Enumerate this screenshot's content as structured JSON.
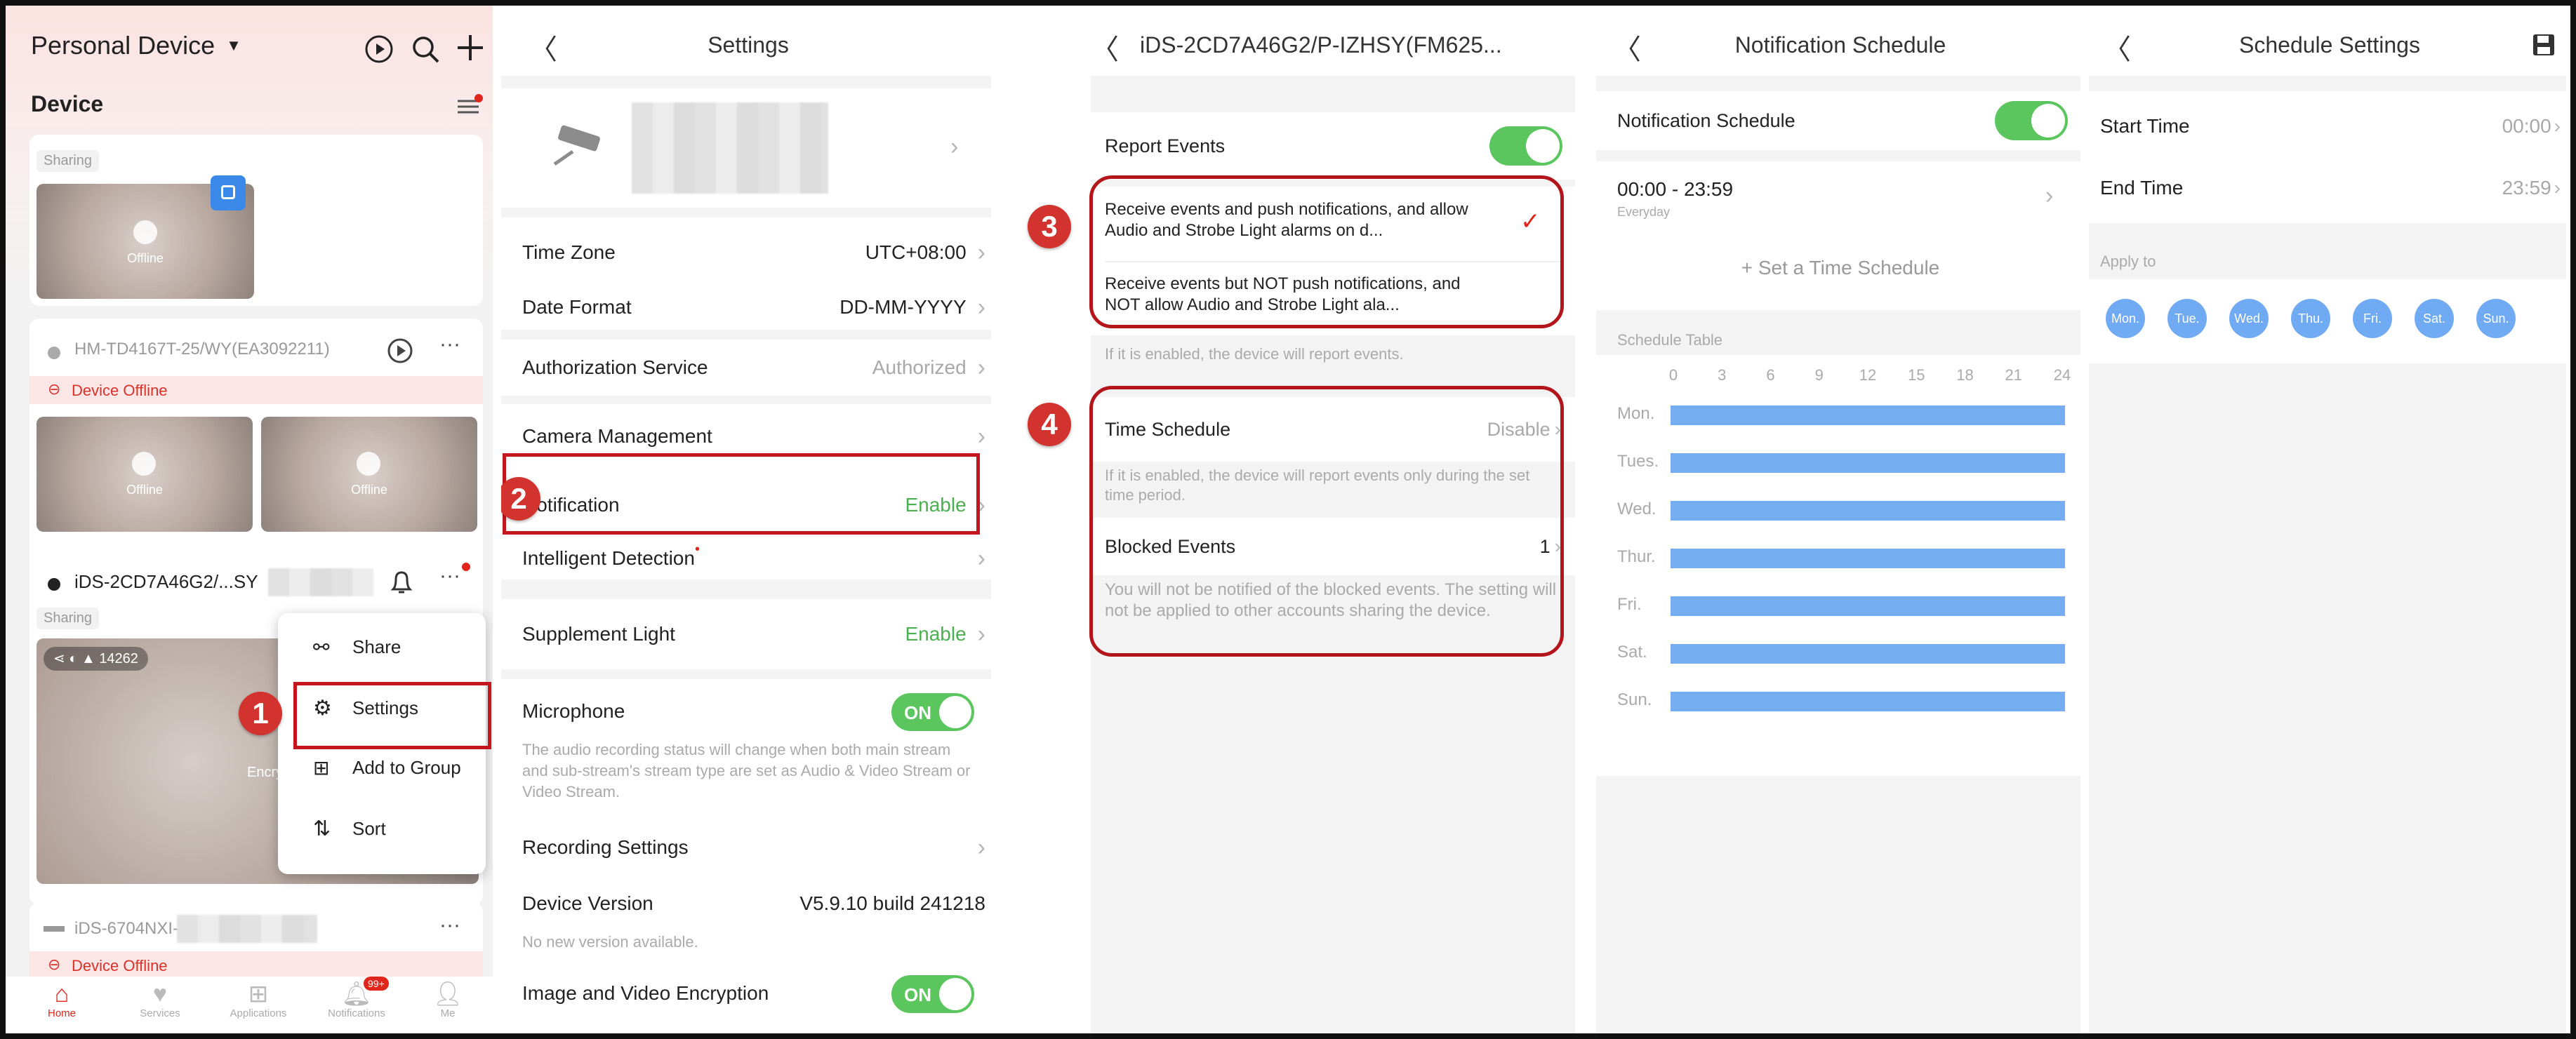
{
  "panel1": {
    "header": {
      "title": "Personal Device",
      "section": "Device"
    },
    "card1": {
      "tag": "Sharing",
      "thumb_text": "Offline"
    },
    "card2": {
      "name": "HM-TD4167T-25/WY(EA3092211)",
      "status": "Device Offline",
      "thumb1_text": "Offline",
      "thumb2_text": "Offline"
    },
    "card3": {
      "name": "iDS-2CD7A46G2/...SY",
      "tag": "Sharing",
      "count": "14262",
      "overlay_text": "Encrypte"
    },
    "card4": {
      "name": "iDS-6704NXI-",
      "status": "Device Offline"
    },
    "menu": {
      "share": "Share",
      "settings": "Settings",
      "add_group": "Add to Group",
      "sort": "Sort"
    },
    "tabs": {
      "home": "Home",
      "services": "Services",
      "applications": "Applications",
      "notifications": "Notifications",
      "me": "Me",
      "badge": "99+"
    },
    "step": "1"
  },
  "panel2": {
    "title": "Settings",
    "rows": {
      "timezone_label": "Time Zone",
      "timezone_value": "UTC+08:00",
      "date_label": "Date Format",
      "date_value": "DD-MM-YYYY",
      "auth_label": "Authorization Service",
      "auth_value": "Authorized",
      "camera_label": "Camera Management",
      "notification_label": "Notification",
      "notification_value": "Enable",
      "intelligent_label": "Intelligent Detection",
      "supplement_label": "Supplement Light",
      "supplement_value": "Enable",
      "mic_label": "Microphone",
      "mic_toggle": "ON",
      "mic_note": "The audio recording status will change when both main stream and sub-stream's stream type are set as Audio & Video Stream or Video Stream.",
      "recording_label": "Recording Settings",
      "version_label": "Device Version",
      "version_value": "V5.9.10 build 241218",
      "version_note": "No new version available.",
      "encryption_label": "Image and Video Encryption",
      "encryption_toggle": "ON"
    },
    "step": "2"
  },
  "panel3": {
    "title": "iDS-2CD7A46G2/P-IZHSY(FM625...",
    "report_events": "Report Events",
    "option1": "Receive events and push notifications, and allow Audio and Strobe Light alarms on d...",
    "option2": "Receive events but NOT push notifications, and NOT allow Audio and Strobe Light ala...",
    "report_note": "If it is enabled, the device will report events.",
    "time_schedule_label": "Time Schedule",
    "time_schedule_value": "Disable",
    "time_note": "If it is enabled, the device will report events only during the set time period.",
    "blocked_label": "Blocked Events",
    "blocked_value": "1",
    "blocked_note": "You will not be notified of the blocked events. The setting will not be applied to other accounts sharing the device.",
    "step3": "3",
    "step4": "4"
  },
  "panel4": {
    "title": "Notification Schedule",
    "toggle_label": "Notification Schedule",
    "time_range": "00:00 - 23:59",
    "repeat": "Everyday",
    "add_schedule": "+ Set a Time Schedule",
    "table_label": "Schedule Table",
    "hours": [
      "0",
      "3",
      "6",
      "9",
      "12",
      "15",
      "18",
      "21",
      "24"
    ],
    "days": [
      "Mon.",
      "Tues.",
      "Wed.",
      "Thur.",
      "Fri.",
      "Sat.",
      "Sun."
    ]
  },
  "panel5": {
    "title": "Schedule Settings",
    "start_label": "Start Time",
    "start_value": "00:00",
    "end_label": "End Time",
    "end_value": "23:59",
    "apply_label": "Apply to",
    "days": [
      "Mon.",
      "Tue.",
      "Wed.",
      "Thu.",
      "Fri.",
      "Sat.",
      "Sun."
    ]
  },
  "colors": {
    "accent_red": "#c4161c",
    "toggle_green": "#5cc65e",
    "enable_green": "#4caf50",
    "schedule_blue": "#75adf2"
  }
}
